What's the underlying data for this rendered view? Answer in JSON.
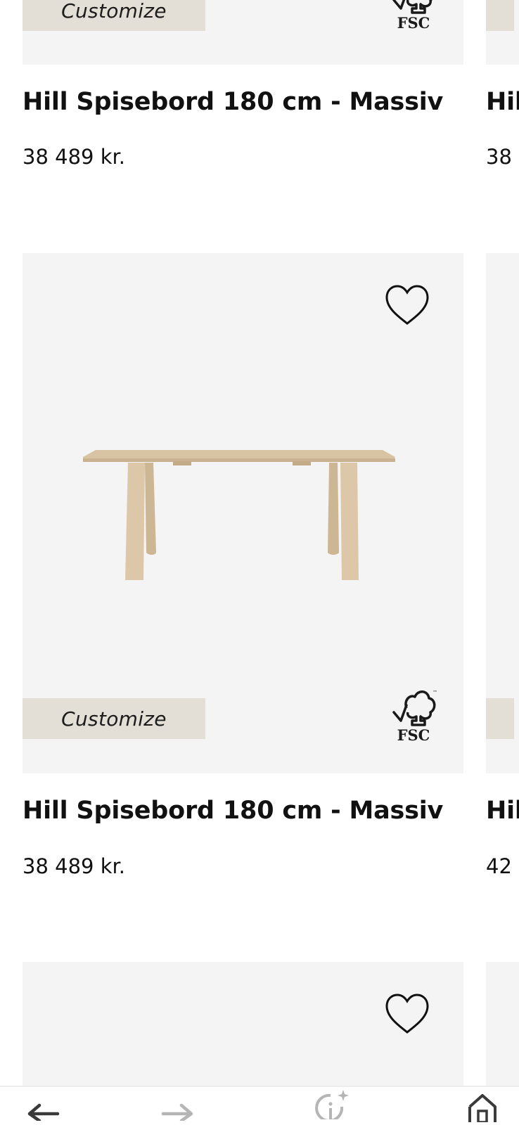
{
  "products": [
    {
      "title": "Hill Spisebord 180 cm - Massiv",
      "price": "38 489 kr.",
      "customize_label": "Customize",
      "fsc_label": "FSC"
    },
    {
      "title": "Hill Spisebord 180 cm - Massiv",
      "price": "38 489 kr.",
      "customize_label": "Customize",
      "fsc_label": "FSC"
    }
  ],
  "peek_column": [
    {
      "title": "Hil",
      "price": "38"
    },
    {
      "title": "Hil",
      "price": "42"
    }
  ],
  "icons": {
    "wishlist": "heart-icon",
    "certification": "fsc-tree-icon",
    "back": "arrow-left-icon",
    "forward": "arrow-right-icon",
    "info": "info-sparkle-icon",
    "home": "home-icon"
  },
  "colors": {
    "card_background": "#f4f4f4",
    "customize_background": "#e3ded6",
    "wood": "#d9c4a4",
    "text": "#111111"
  }
}
